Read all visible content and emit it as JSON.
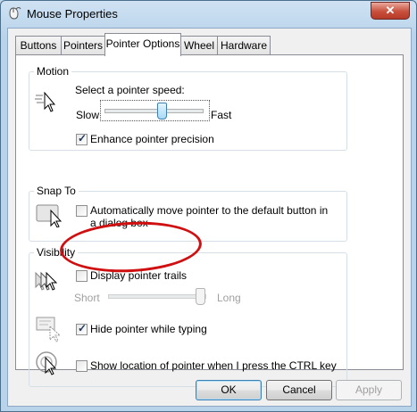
{
  "window": {
    "title": "Mouse Properties",
    "close_label": "✕"
  },
  "tabs": [
    {
      "label": "Buttons"
    },
    {
      "label": "Pointers"
    },
    {
      "label": "Pointer Options"
    },
    {
      "label": "Wheel"
    },
    {
      "label": "Hardware"
    }
  ],
  "active_tab": "Pointer Options",
  "motion": {
    "title": "Motion",
    "speed_label": "Select a pointer speed:",
    "slow_label": "Slow",
    "fast_label": "Fast",
    "speed_value": 0.6,
    "enhance_label": "Enhance pointer precision",
    "enhance_checked": true,
    "icon": "pointer-speed-icon"
  },
  "snap_to": {
    "title": "Snap To",
    "label": "Automatically move pointer to the default button in a dialog box",
    "checked": false,
    "icon": "snap-to-button-icon"
  },
  "visibility": {
    "title": "Visibility",
    "trails_label": "Display pointer trails",
    "trails_checked": false,
    "short_label": "Short",
    "long_label": "Long",
    "trails_value": 1.0,
    "hide_label": "Hide pointer while typing",
    "hide_checked": true,
    "show_location_label": "Show location of pointer when I press the CTRL key",
    "show_location_checked": false,
    "icons": [
      "pointer-trails-icon",
      "hide-pointer-icon",
      "show-location-icon"
    ]
  },
  "buttons": {
    "ok": "OK",
    "cancel": "Cancel",
    "apply": "Apply"
  },
  "annotation": {
    "color": "#d01010",
    "shape": "red-ellipse-highlight"
  }
}
